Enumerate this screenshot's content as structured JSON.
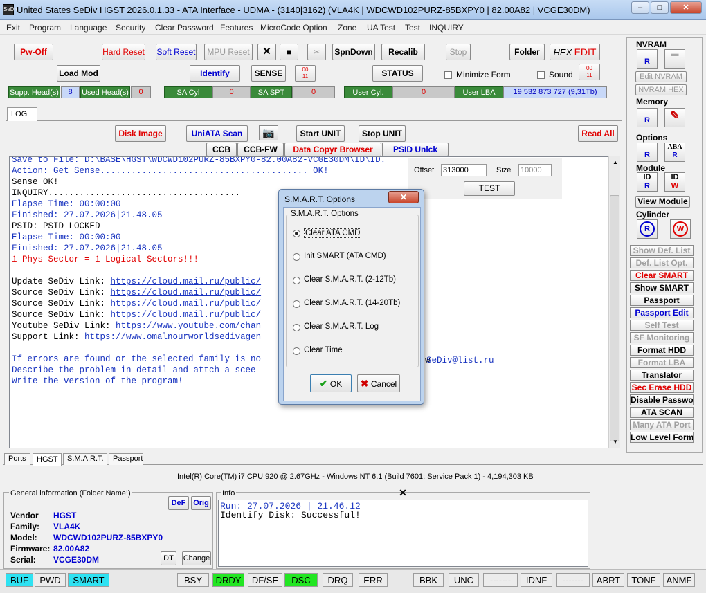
{
  "window": {
    "title": "United States  SeDiv HGST  2026.0.1.33 - ATA Interface  - UDMA -  (3140|3162) (VLA4K | WDCWD102PURZ-85BXPY0 | 82.00A82 | VCGE30DM)",
    "app_icon": "SeDiv",
    "min": "–",
    "max": "□",
    "close": "✕"
  },
  "menu": [
    "Exit",
    "Program",
    "Language",
    "Security",
    "Clear Password",
    "Features",
    "MicroCode Option",
    "Zone",
    "UA Test",
    "Test",
    "INQUIRY"
  ],
  "toolbar": {
    "pw_off": "Pw-Off",
    "hard_reset": "Hard Reset",
    "soft_reset": "Soft Reset",
    "mpu_reset": "MPU Reset",
    "close_x": "✕",
    "save_glyph": "■",
    "tools_glyph": "✂",
    "spn_down": "SpnDown",
    "recalib": "Recalib",
    "stop": "Stop",
    "folder": "Folder",
    "hex_edit_hex": "HEX",
    "hex_edit_edit": "EDIT",
    "load_mod": "Load Mod",
    "identify": "Identify",
    "sense": "SENSE",
    "status": "STATUS",
    "minimize_form": "Minimize Form",
    "sound": "Sound",
    "icon_digits_top": "00",
    "icon_digits_bottom": "11"
  },
  "fields": {
    "supp_heads_label": "Supp. Head(s)",
    "supp_heads_value": "8",
    "used_heads_label": "Used Head(s)",
    "used_heads_value": "0",
    "sa_cyl_label": "SA Cyl",
    "sa_cyl_value": "0",
    "sa_spt_label": "SA SPT",
    "sa_spt_value": "0",
    "user_cyl_label": "User Cyl.",
    "user_cyl_value": "0",
    "user_lba_label": "User LBA",
    "user_lba_value": "19 532 873 727  (9,31Tb)"
  },
  "log_tab": "LOG",
  "log_toolbar": {
    "disk_image": "Disk Image",
    "uniata_scan": "UniATA Scan",
    "start_unit": "Start UNIT",
    "stop_unit": "Stop UNIT",
    "read_all": "Read All",
    "ccb": "CCB",
    "ccb_fw": "CCB-FW",
    "data_copyr": "Data Copyr Browser",
    "psid_unlck": "PSID Unlck"
  },
  "offset": {
    "offset_label": "Offset",
    "offset_value": "313000",
    "size_label": "Size",
    "size_value": "10000",
    "test": "TEST"
  },
  "log_lines": [
    {
      "text": "Save to File: D:\\BASE\\HGST\\WDCWD102PURZ-85BXPY0-82.00A82-VCGE30DM\\ID\\ID.",
      "cls": "blue"
    },
    {
      "text": "Action: Get Sense........................................ OK!",
      "cls": "blue"
    },
    {
      "text": "Sense OK!",
      "cls": "blk"
    },
    {
      "text": "INQUIRY.....................................",
      "cls": "blk"
    },
    {
      "text": "Elapse Time: 00:00:00",
      "cls": "blue"
    },
    {
      "text": "Finished: 27.07.2026|21.48.05",
      "cls": "blue"
    },
    {
      "text": "PSID: PSID LOCKED",
      "cls": "blk"
    },
    {
      "text": "Elapse Time: 00:00:00",
      "cls": "blue"
    },
    {
      "text": "Finished: 27.07.2026|21.48.05",
      "cls": "blue"
    },
    {
      "text": "1 Phys Sector = 1 Logical Sectors!!!",
      "cls": "red"
    },
    {
      "text": "",
      "cls": "blk"
    },
    {
      "text": "Update SeDiv Link: ",
      "cls": "blk",
      "link": "https://cloud.mail.ru/public/"
    },
    {
      "text": "Source SeDiv Link: ",
      "cls": "blk",
      "link": "https://cloud.mail.ru/public/"
    },
    {
      "text": "Source SeDiv Link: ",
      "cls": "blk",
      "link": "https://cloud.mail.ru/public/"
    },
    {
      "text": "Source SeDiv Link: ",
      "cls": "blk",
      "link": "https://cloud.mail.ru/public/"
    },
    {
      "text": "Youtube SeDiv Link: ",
      "cls": "blk",
      "link": "https://www.youtube.com/chan"
    },
    {
      "text": "Support Link: ",
      "cls": "blk",
      "link": "https://www.omalnourworldsedivagen"
    },
    {
      "text": "",
      "cls": "blk"
    },
    {
      "text": "If errors are found or the selected family is no",
      "cls": "blue"
    },
    {
      "text": "Describe the problem in detail and attch a scee",
      "cls": "blue"
    },
    {
      "text": "Write the version of the program!",
      "cls": "blue"
    }
  ],
  "log_tail": {
    "email": "SeDiv@list.ru",
    "w": "w"
  },
  "smart_dialog": {
    "title": "S.M.A.R.T. Options",
    "close": "✕",
    "group": "S.M.A.R.T. Options",
    "options": [
      "Clear ATA CMD",
      "Init SMART (ATA CMD)",
      "Clear S.M.A.R.T. (2-12Tb)",
      "Clear S.M.A.R.T. (14-20Tb)",
      "Clear S.M.A.R.T. Log",
      "Clear Time"
    ],
    "selected": 0,
    "ok": "OK",
    "cancel": "Cancel"
  },
  "right_panel": {
    "nvram": "NVRAM",
    "edit_nvram": "Edit NVRAM",
    "nvram_hex": "NVRAM HEX",
    "memory": "Memory",
    "options": "Options",
    "aba": "ABA",
    "module": "Module",
    "id": "ID",
    "view_module": "View Module",
    "cylinder": "Cylinder",
    "r": "R",
    "w": "W",
    "buttons": [
      {
        "label": "Show Def. List",
        "cls": "g"
      },
      {
        "label": "Def. List Opt.",
        "cls": "g"
      },
      {
        "label": "Clear SMART",
        "cls": "rr"
      },
      {
        "label": "Show SMART",
        "cls": ""
      },
      {
        "label": "Passport",
        "cls": ""
      },
      {
        "label": "Passport Edit",
        "cls": "bb"
      },
      {
        "label": "Self Test",
        "cls": "g"
      },
      {
        "label": "SF Monitoring",
        "cls": "g"
      },
      {
        "label": "Format HDD",
        "cls": ""
      },
      {
        "label": "Format LBA",
        "cls": "g"
      },
      {
        "label": "Translator",
        "cls": ""
      },
      {
        "label": "Sec Erase HDD",
        "cls": "rr"
      },
      {
        "label": "Disable Password",
        "cls": ""
      },
      {
        "label": "ATA SCAN",
        "cls": ""
      },
      {
        "label": "Many ATA Port",
        "cls": "g"
      },
      {
        "label": "Low Level Format",
        "cls": ""
      }
    ]
  },
  "bottom_tabs": [
    "Ports",
    "HGST",
    "S.M.A.R.T.",
    "Passport"
  ],
  "cpu_info": "Intel(R) Core(TM) i7 CPU 920  @ 2.67GHz - Windows NT 6.1 (Build 7601: Service Pack 1) - 4,194,303 KB",
  "general_info": {
    "title": "General information (Folder Name!)",
    "def": "DeF",
    "orig": "Orig",
    "dt": "DT",
    "change": "Change",
    "rows": [
      {
        "label": "Vendor",
        "value": "HGST"
      },
      {
        "label": "Family:",
        "value": "VLA4K"
      },
      {
        "label": "Model:",
        "value": "WDCWD102PURZ-85BXPY0"
      },
      {
        "label": "Firmware:",
        "value": "82.00A82"
      },
      {
        "label": "Serial:",
        "value": "VCGE30DM"
      }
    ]
  },
  "info_box": {
    "title": "Info",
    "close": "✕",
    "line1": "Run: 27.07.2026 | 21.46.12",
    "line2": "Identify Disk: Successful!"
  },
  "status": [
    {
      "label": "BUF",
      "cls": "cy"
    },
    {
      "label": "PWD",
      "cls": ""
    },
    {
      "label": "SMART",
      "cls": "cy"
    },
    {
      "label": "BSY",
      "cls": ""
    },
    {
      "label": "DRDY",
      "cls": "gr"
    },
    {
      "label": "DF/SE",
      "cls": ""
    },
    {
      "label": "DSC",
      "cls": "gr"
    },
    {
      "label": "DRQ",
      "cls": ""
    },
    {
      "label": "ERR",
      "cls": ""
    },
    {
      "label": "BBK",
      "cls": ""
    },
    {
      "label": "UNC",
      "cls": ""
    },
    {
      "label": "-------",
      "cls": ""
    },
    {
      "label": "IDNF",
      "cls": ""
    },
    {
      "label": "-------",
      "cls": ""
    },
    {
      "label": "ABRT",
      "cls": ""
    },
    {
      "label": "TONF",
      "cls": ""
    },
    {
      "label": "ANMF",
      "cls": ""
    }
  ]
}
